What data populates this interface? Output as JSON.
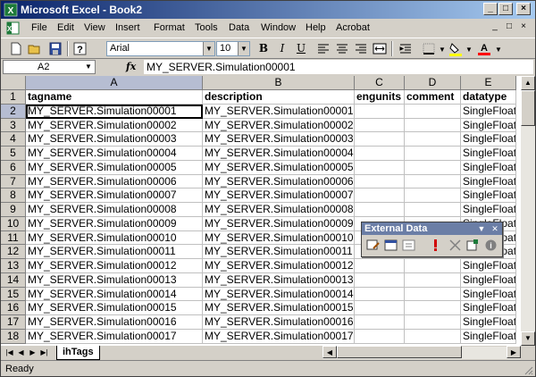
{
  "window": {
    "title": "Microsoft Excel - Book2",
    "title_icon": "excel-icon",
    "controls": [
      "_",
      "□",
      "×"
    ]
  },
  "menubar": {
    "items": [
      "File",
      "Edit",
      "View",
      "Insert",
      "Format",
      "Tools",
      "Data",
      "Window",
      "Help",
      "Acrobat"
    ],
    "right_controls": [
      "_",
      "□",
      "×"
    ]
  },
  "toolbar": {
    "font_name": "Arial",
    "font_size": "10",
    "icons": [
      "new-icon",
      "open-icon",
      "save-icon",
      "help-icon",
      "bold-icon",
      "italic-icon",
      "underline-icon",
      "align-left-icon",
      "align-center-icon",
      "align-right-icon",
      "merge-center-icon",
      "increase-indent-icon",
      "borders-icon",
      "fill-color-icon",
      "font-color-icon"
    ],
    "fill_color": "#ffff00",
    "font_color": "#ff0000"
  },
  "formula_bar": {
    "name_box": "A2",
    "fx": "fx",
    "formula": "MY_SERVER.Simulation00001"
  },
  "grid": {
    "columns": [
      "A",
      "B",
      "C",
      "D",
      "E"
    ],
    "selected_column": "A",
    "selected_row": "2",
    "row_numbers": [
      "1",
      "2",
      "3",
      "4",
      "5",
      "6",
      "7",
      "8",
      "9",
      "10",
      "11",
      "12",
      "13",
      "14",
      "15",
      "16",
      "17",
      "18"
    ],
    "header_row": [
      "tagname",
      "description",
      "engunits",
      "comment",
      "datatype"
    ],
    "rows": [
      [
        "MY_SERVER.Simulation00001",
        "MY_SERVER.Simulation00001",
        "",
        "",
        "SingleFloat"
      ],
      [
        "MY_SERVER.Simulation00002",
        "MY_SERVER.Simulation00002",
        "",
        "",
        "SingleFloat"
      ],
      [
        "MY_SERVER.Simulation00003",
        "MY_SERVER.Simulation00003",
        "",
        "",
        "SingleFloat"
      ],
      [
        "MY_SERVER.Simulation00004",
        "MY_SERVER.Simulation00004",
        "",
        "",
        "SingleFloat"
      ],
      [
        "MY_SERVER.Simulation00005",
        "MY_SERVER.Simulation00005",
        "",
        "",
        "SingleFloat"
      ],
      [
        "MY_SERVER.Simulation00006",
        "MY_SERVER.Simulation00006",
        "",
        "",
        "SingleFloat"
      ],
      [
        "MY_SERVER.Simulation00007",
        "MY_SERVER.Simulation00007",
        "",
        "",
        "SingleFloat"
      ],
      [
        "MY_SERVER.Simulation00008",
        "MY_SERVER.Simulation00008",
        "",
        "",
        "SingleFloat"
      ],
      [
        "MY_SERVER.Simulation00009",
        "MY_SERVER.Simulation00009",
        "",
        "",
        "SingleFloat"
      ],
      [
        "MY_SERVER.Simulation00010",
        "MY_SERVER.Simulation00010",
        "",
        "",
        "SingleFloat"
      ],
      [
        "MY_SERVER.Simulation00011",
        "MY_SERVER.Simulation00011",
        "",
        "",
        "SingleFloat"
      ],
      [
        "MY_SERVER.Simulation00012",
        "MY_SERVER.Simulation00012",
        "",
        "",
        "SingleFloat"
      ],
      [
        "MY_SERVER.Simulation00013",
        "MY_SERVER.Simulation00013",
        "",
        "",
        "SingleFloat"
      ],
      [
        "MY_SERVER.Simulation00014",
        "MY_SERVER.Simulation00014",
        "",
        "",
        "SingleFloat"
      ],
      [
        "MY_SERVER.Simulation00015",
        "MY_SERVER.Simulation00015",
        "",
        "",
        "SingleFloat"
      ],
      [
        "MY_SERVER.Simulation00016",
        "MY_SERVER.Simulation00016",
        "",
        "",
        "SingleFloat"
      ],
      [
        "MY_SERVER.Simulation00017",
        "MY_SERVER.Simulation00017",
        "",
        "",
        "SingleFloat"
      ]
    ]
  },
  "sheet_tabs": {
    "active": "ihTags"
  },
  "status": {
    "text": "Ready"
  },
  "external_data_toolbar": {
    "title": "External Data",
    "icons": [
      "edit-query-icon",
      "data-range-properties-icon",
      "query-parameters-icon",
      "refresh-data-icon",
      "cancel-refresh-icon",
      "refresh-all-icon",
      "refresh-status-icon"
    ]
  }
}
